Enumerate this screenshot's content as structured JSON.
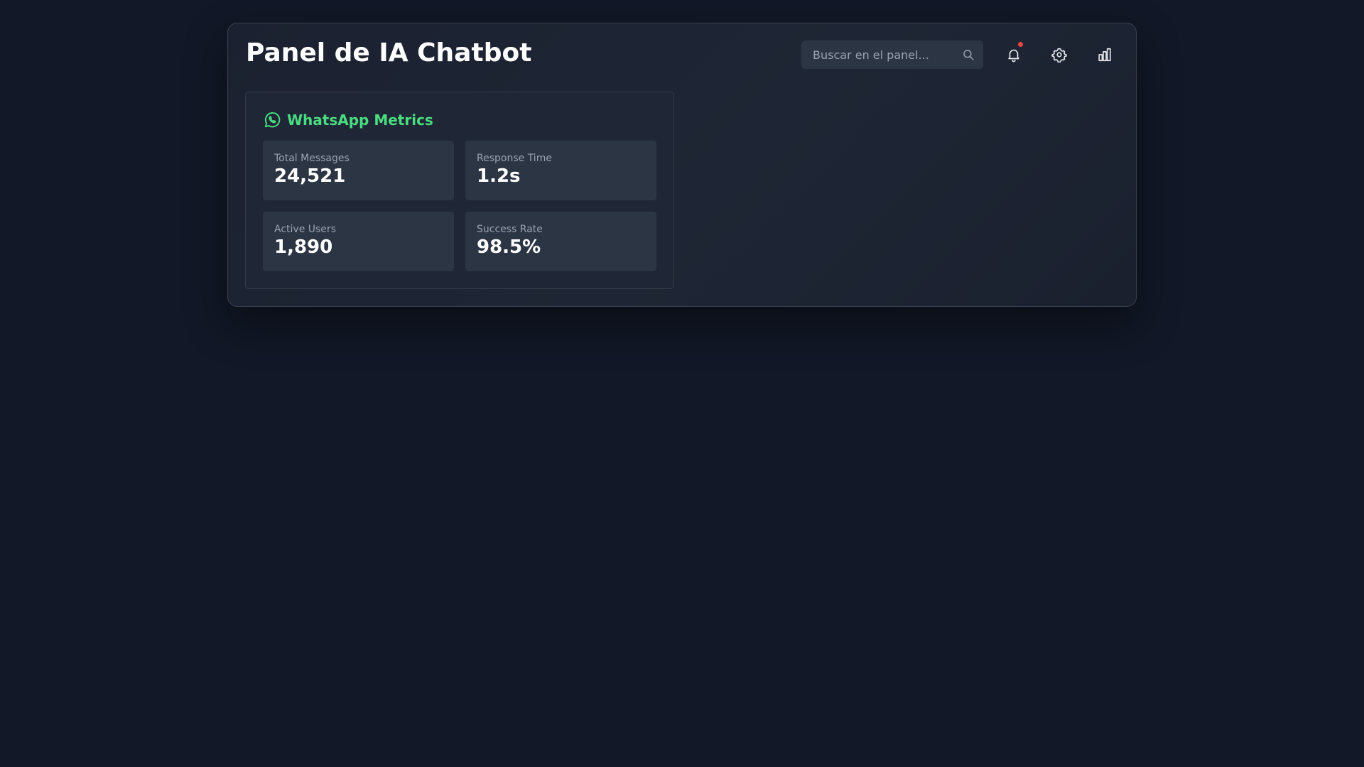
{
  "header": {
    "title": "Panel de IA Chatbot",
    "search_placeholder": "Buscar en el panel...",
    "icons": [
      "search-icon",
      "bell-icon",
      "gear-icon",
      "bar-chart-icon"
    ],
    "notification_dot_color": "#ef4444"
  },
  "whatsapp_card": {
    "title": "WhatsApp Metrics",
    "icon": "whatsapp-icon",
    "accent_color": "#4ade80",
    "metrics": [
      {
        "label": "Total Messages",
        "value": "24,521"
      },
      {
        "label": "Response Time",
        "value": "1.2s"
      },
      {
        "label": "Active Users",
        "value": "1,890"
      },
      {
        "label": "Success Rate",
        "value": "98.5%"
      }
    ]
  }
}
